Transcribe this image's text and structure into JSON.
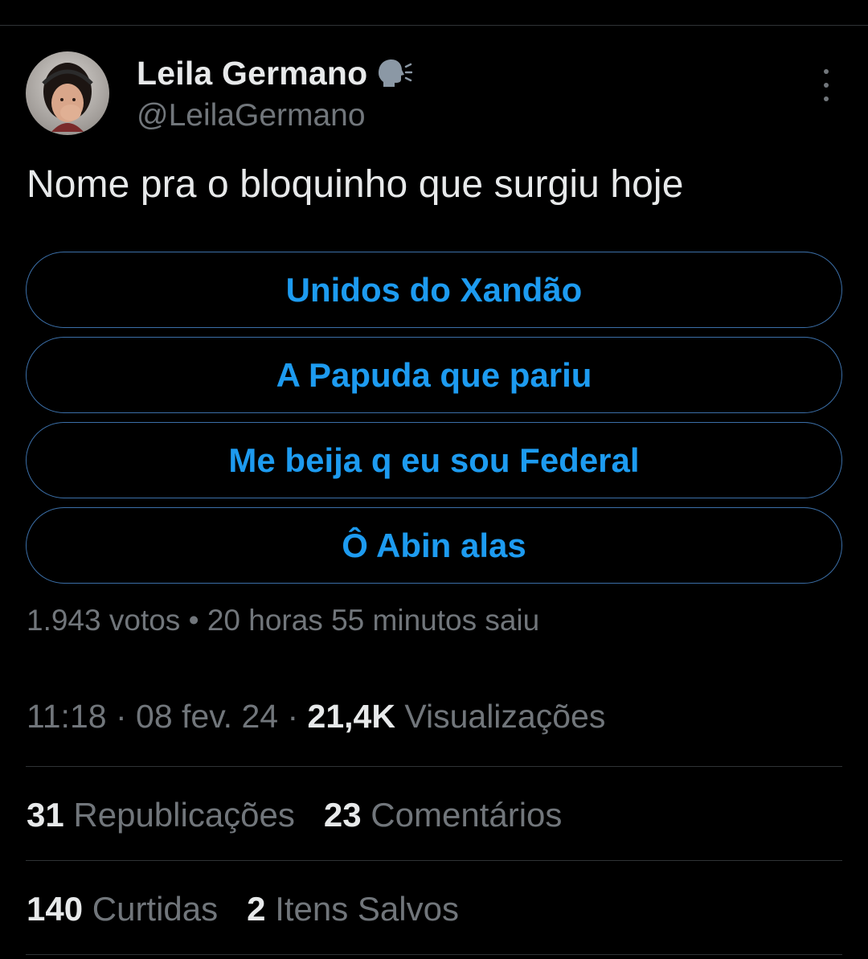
{
  "tweet": {
    "author": {
      "display_name": "Leila Germano",
      "handle": "@LeilaGermano",
      "badge_icon": "speaking-head-icon"
    },
    "text": "Nome pra o bloquinho que surgiu hoje",
    "poll": {
      "options": [
        "Unidos do Xandão",
        "A Papuda que pariu",
        "Me beija q eu sou Federal",
        "Ô Abin alas"
      ],
      "meta": "1.943 votos • 20 horas 55 minutos saiu"
    },
    "time": "11:18",
    "date": "08 fev. 24",
    "views_count": "21,4K",
    "views_label": "Visualizações",
    "separator": "·",
    "stats": {
      "reposts_count": "31",
      "reposts_label": "Republicações",
      "comments_count": "23",
      "comments_label": "Comentários",
      "likes_count": "140",
      "likes_label": "Curtidas",
      "saves_count": "2",
      "saves_label": "Itens Salvos"
    }
  },
  "colors": {
    "background": "#000000",
    "text_primary": "#e7e9ea",
    "text_secondary": "#71767b",
    "accent": "#1d9bf0",
    "divider": "#2f3336"
  }
}
